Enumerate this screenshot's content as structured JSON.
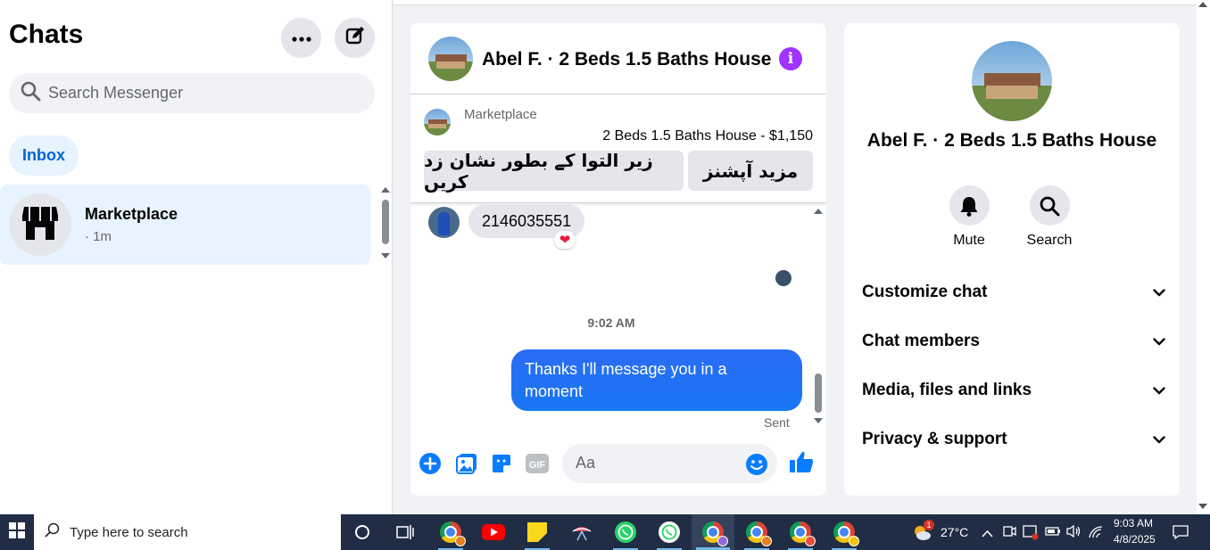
{
  "sidebar": {
    "title": "Chats",
    "search_placeholder": "Search Messenger",
    "filter_label": "Inbox",
    "chats": [
      {
        "name": "Marketplace",
        "time": "· 1m"
      }
    ]
  },
  "conversation": {
    "title": "Abel F. · 2 Beds 1.5 Baths House",
    "marketplace_label": "Marketplace",
    "listing": "2 Beds 1.5 Baths House - $1,150",
    "buttons": {
      "mark_pending": "زیر التوا کے بطور نشان زد کریں",
      "more_options": "مزید آپشنز"
    },
    "messages": [
      {
        "direction": "incoming",
        "text": "2146035551",
        "reaction": "❤"
      },
      {
        "direction": "timestamp",
        "text": "9:02 AM"
      },
      {
        "direction": "outgoing",
        "text": "Thanks I'll message you in a moment"
      }
    ],
    "status": "Sent",
    "composer_placeholder": "Aa"
  },
  "details": {
    "name": "Abel F. · 2 Beds 1.5 Baths House",
    "actions": [
      "Mute",
      "Search"
    ],
    "sections": [
      "Customize chat",
      "Chat members",
      "Media, files and links",
      "Privacy & support"
    ]
  },
  "taskbar": {
    "search_placeholder": "Type here to search",
    "weather": "27°C",
    "weather_badge": "1",
    "time": "9:03 AM",
    "date": "4/8/2025"
  },
  "colors": {
    "accent": "#0a7cff",
    "inbox_bg": "#e7f3ff",
    "info": "#a033ff",
    "taskbar": "#202d44"
  }
}
